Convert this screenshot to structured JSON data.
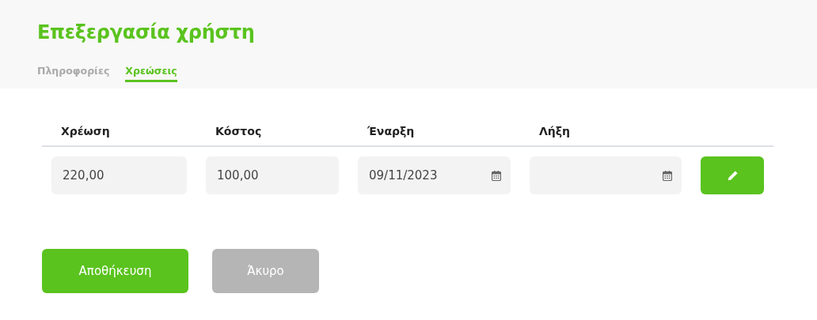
{
  "title": "Επεξεργασία χρήστη",
  "tabs": [
    {
      "label": "Πληροφορίες",
      "selected": false
    },
    {
      "label": "Χρεώσεις",
      "selected": true
    }
  ],
  "table": {
    "columns": [
      "Χρέωση",
      "Κόστος",
      "Έναρξη",
      "Λήξη"
    ],
    "rows": [
      {
        "cells": [
          {
            "kind": "text",
            "value": "220,00"
          },
          {
            "kind": "text",
            "value": "100,00"
          },
          {
            "kind": "date",
            "value": "09/11/2023"
          },
          {
            "kind": "date"
          }
        ]
      }
    ]
  },
  "buttons": [
    {
      "label": "Αποθήκευση",
      "kind": "primary"
    },
    {
      "label": "Άκυρο",
      "kind": "secondary"
    }
  ]
}
